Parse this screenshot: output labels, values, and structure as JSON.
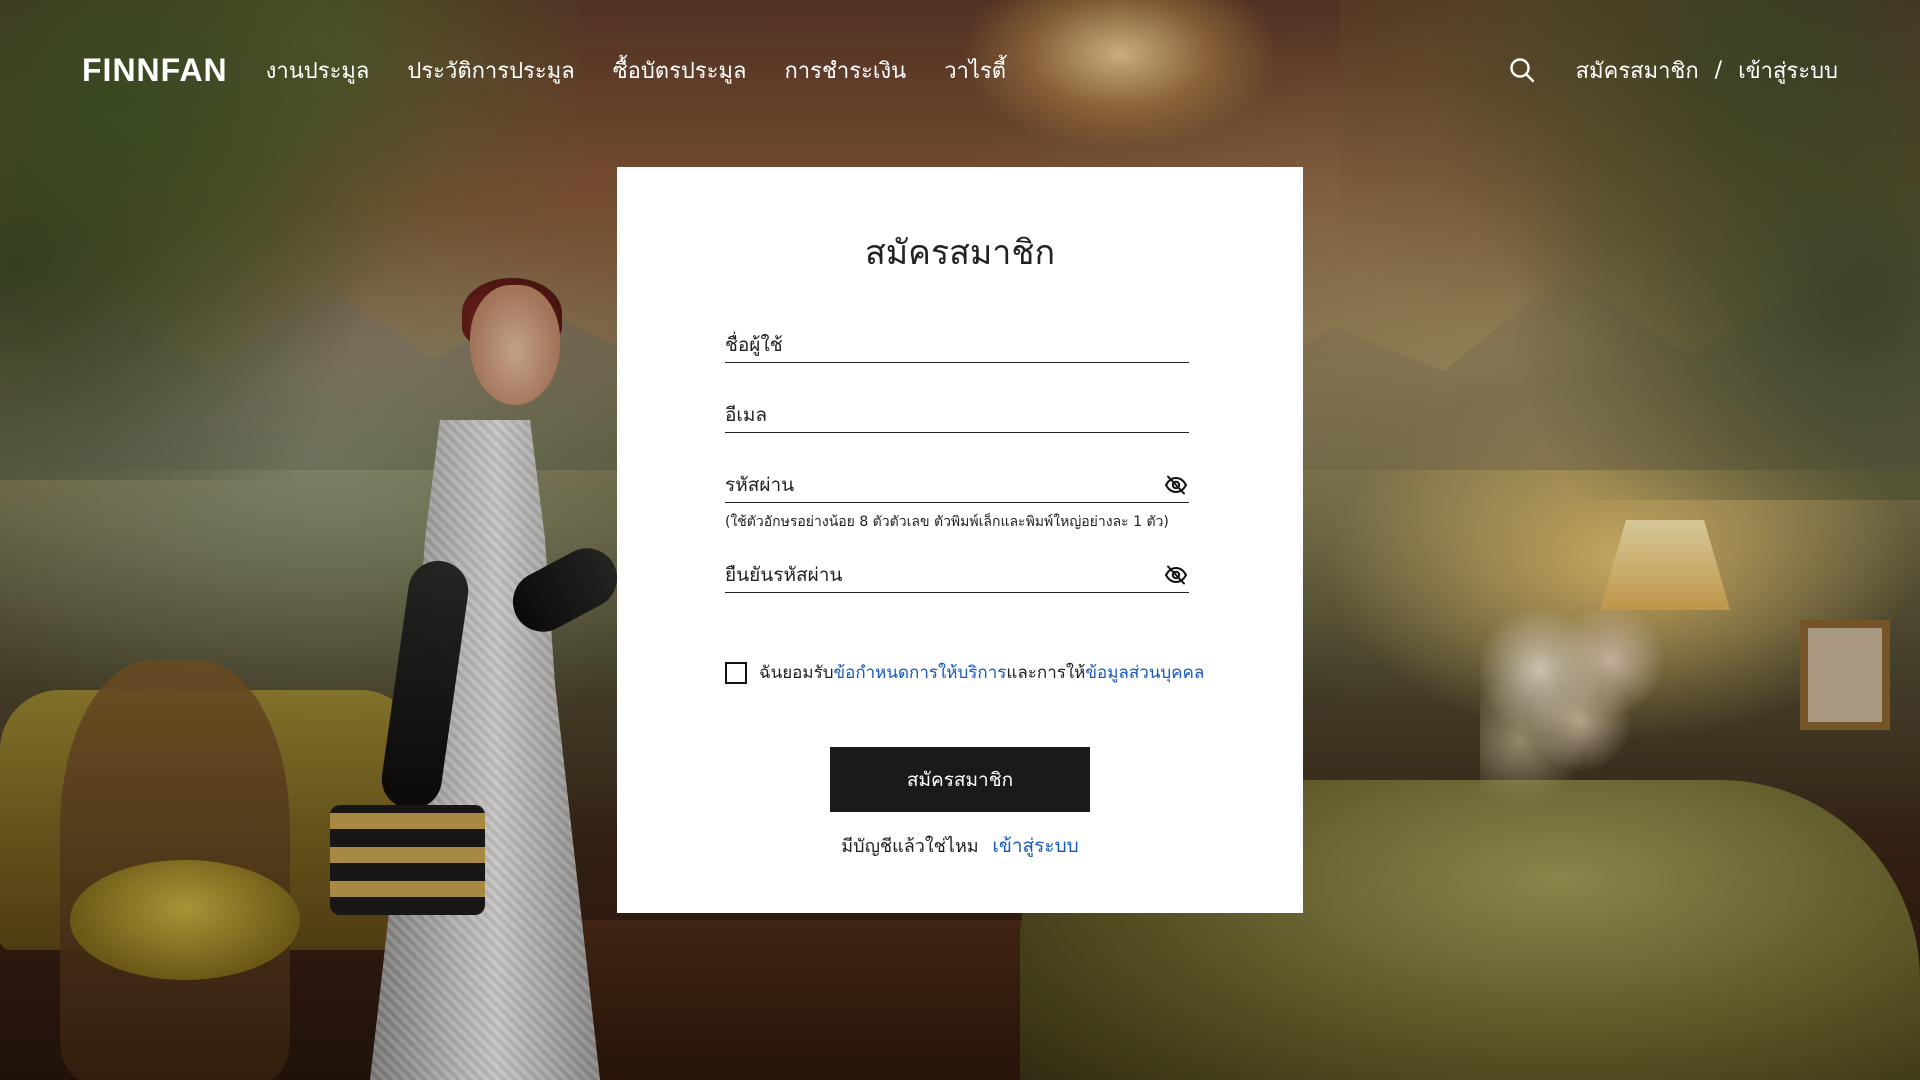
{
  "brand": {
    "logo_text": "FINNFAN"
  },
  "nav": {
    "items": [
      {
        "label": "งานประมูล"
      },
      {
        "label": "ประวัติการประมูล"
      },
      {
        "label": "ซื้อบัตรประมูล"
      },
      {
        "label": "การชำระเงิน"
      },
      {
        "label": "วาไรตี้"
      }
    ]
  },
  "header_right": {
    "search_icon": "search-icon",
    "register_label": "สมัครสมาชิก",
    "separator": "/",
    "login_label": "เข้าสู่ระบบ"
  },
  "form": {
    "title": "สมัครสมาชิก",
    "username": {
      "label": "ชื่อผู้ใช้",
      "value": ""
    },
    "email": {
      "label": "อีเมล",
      "value": ""
    },
    "password": {
      "label": "รหัสผ่าน",
      "value": "",
      "visibility_icon": "eye-off-icon",
      "hint": "(ใช้ตัวอักษรอย่างน้อย 8 ตัวตัวเลข ตัวพิมพ์เล็กและพิมพ์ใหญ่อย่างละ 1 ตัว)"
    },
    "confirm_password": {
      "label": "ยืนยันรหัสผ่าน",
      "value": "",
      "visibility_icon": "eye-off-icon"
    },
    "consent": {
      "checked": false,
      "prefix": "ฉันยอมรับ",
      "terms_link": "ข้อกำหนดการให้บริการ",
      "middle": "และการให้",
      "privacy_link": "ข้อมูลส่วนบุคคล"
    },
    "submit_label": "สมัครสมาชิก",
    "have_account_text": "มีบัญชีแล้วใช่ไหม",
    "login_link": "เข้าสู่ระบบ"
  },
  "colors": {
    "link": "#1557c2",
    "button_bg": "#1a1a1a",
    "card_bg": "#ffffff",
    "header_text": "#ffffff"
  }
}
